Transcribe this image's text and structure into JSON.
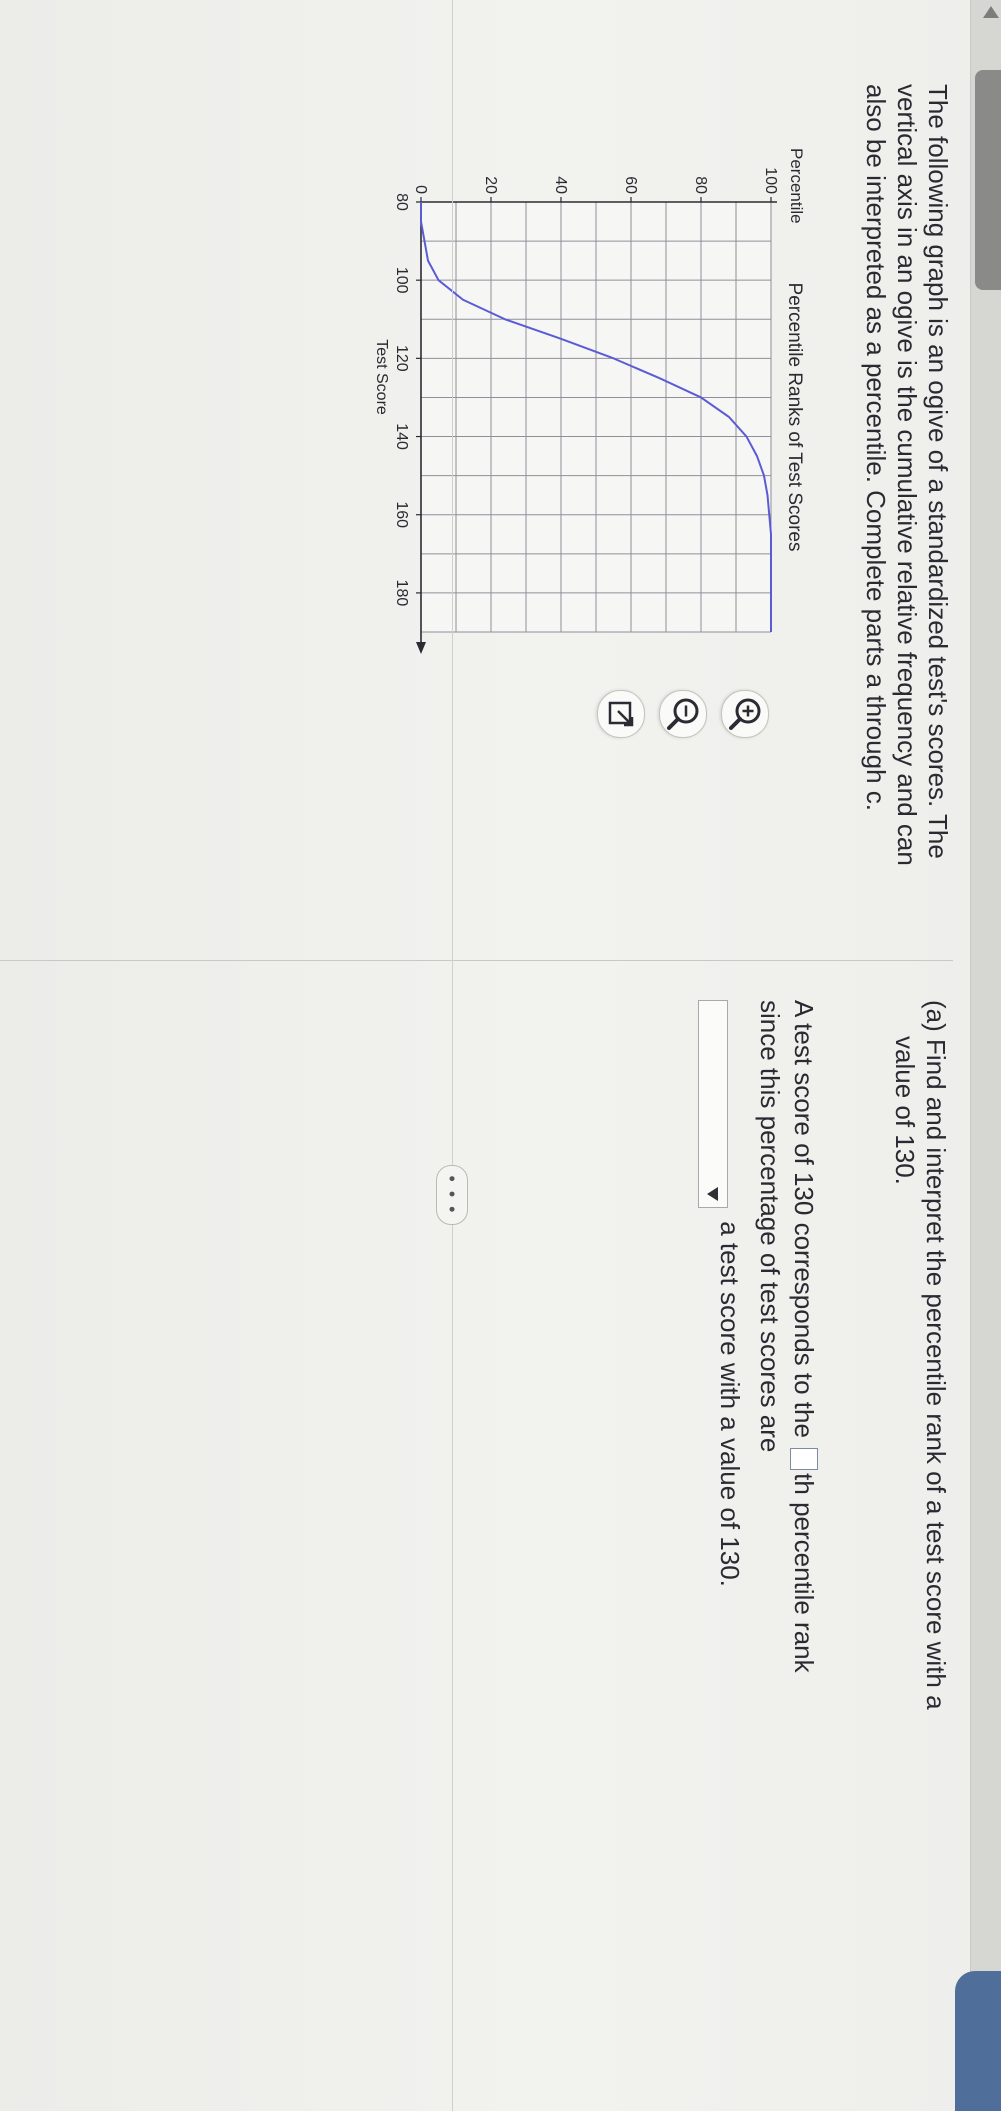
{
  "intro": {
    "line1": "The following graph is an ogive of a standardized test's scores. The",
    "line2": "vertical axis in an ogive is the cumulative relative frequency and can",
    "line3": "also be interpreted as a percentile. Complete parts a through c."
  },
  "question": {
    "part_a_line1": "(a) Find and interpret the percentile rank of a test score with a",
    "part_a_line2": "value of 130.",
    "answer_text1": "A test score of 130 corresponds to the",
    "answer_text2": "th percentile rank",
    "answer_text3": "since this percentage of test scores are",
    "answer_text4": "a test score with a value of 130.",
    "percentile_value": "",
    "dropdown_selected": ""
  },
  "more_label": "• • •",
  "icons": {
    "zoom_in": "zoom-in-icon",
    "zoom_out": "zoom-out-icon",
    "popout": "external-link-icon",
    "more": "ellipsis-icon"
  },
  "colors": {
    "curve": "#5b5bd6",
    "grid": "#8f8f9a",
    "text": "#2a2a33"
  },
  "chart_data": {
    "type": "line",
    "title": "Percentile Ranks of Test Scores",
    "xlabel": "Test Score",
    "ylabel": "Percentile",
    "xlim": [
      80,
      190
    ],
    "ylim": [
      0,
      100
    ],
    "x_ticks": [
      80,
      100,
      120,
      140,
      160,
      180
    ],
    "y_ticks": [
      0,
      20,
      40,
      60,
      80,
      100
    ],
    "grid": true,
    "series": [
      {
        "x": [
          80,
          85,
          90,
          95,
          100,
          105,
          110,
          115,
          120,
          125,
          130,
          135,
          140,
          145,
          150,
          155,
          160,
          165,
          170,
          175,
          180,
          185,
          190
        ],
        "values": [
          0,
          0,
          1,
          2,
          5,
          12,
          24,
          40,
          55,
          68,
          80,
          88,
          93,
          96,
          98,
          99,
          99.5,
          100,
          100,
          100,
          100,
          100,
          100
        ]
      }
    ]
  }
}
